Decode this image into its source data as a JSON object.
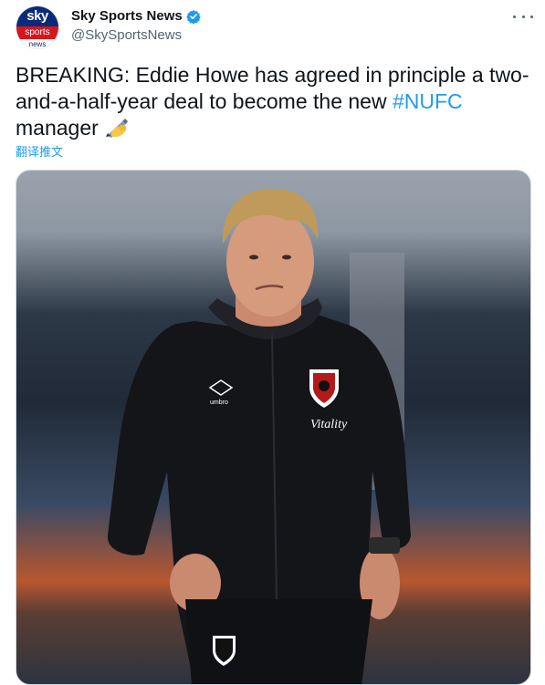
{
  "account": {
    "display_name": "Sky Sports News",
    "handle": "@SkySportsNews",
    "avatar_text": {
      "top": "sky",
      "middle": "sports",
      "bottom": "news"
    }
  },
  "tweet": {
    "text_prefix": "BREAKING: Eddie Howe has agreed in principle a two-and-a-half-year deal to become the new ",
    "hashtag": "#NUFC",
    "text_suffix": "\nmanager",
    "emoji_icon": "writing-hand-icon",
    "translate_label": "翻译推文"
  },
  "media": {
    "jacket_brand": "umbro",
    "sponsor": "Vitality"
  },
  "colors": {
    "link": "#1d9bf0",
    "verified": "#1d9bf0",
    "text": "#0f1419",
    "secondary": "#536471"
  }
}
